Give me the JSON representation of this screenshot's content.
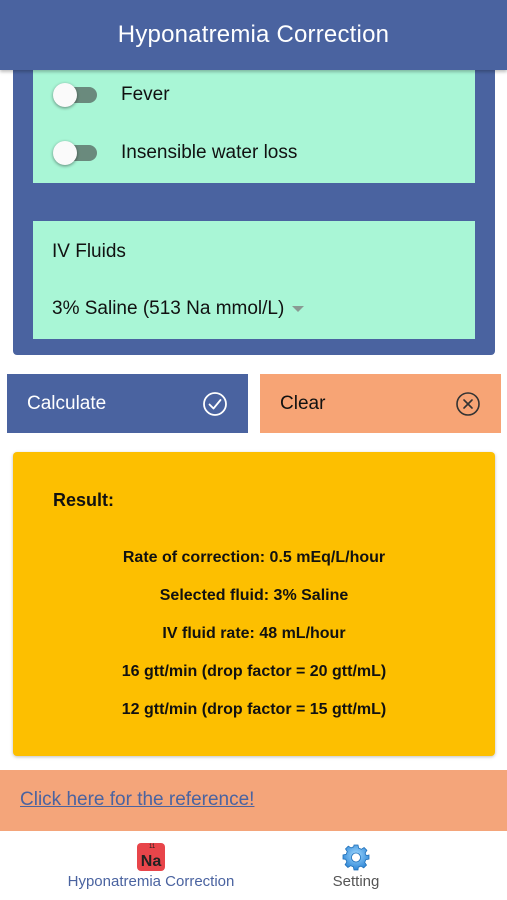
{
  "header": {
    "title": "Hyponatremia Correction"
  },
  "toggles": [
    {
      "label": "Fever",
      "state": "off"
    },
    {
      "label": "Insensible water loss",
      "state": "off"
    }
  ],
  "iv": {
    "title": "IV Fluids",
    "selected": "3% Saline (513 Na mmol/L)"
  },
  "buttons": {
    "calculate": "Calculate",
    "clear": "Clear"
  },
  "result": {
    "title": "Result:",
    "lines": [
      "Rate of correction: 0.5 mEq/L/hour",
      "Selected fluid: 3% Saline",
      "IV fluid rate: 48 mL/hour",
      "16 gtt/min (drop factor = 20 gtt/mL)",
      "12 gtt/min (drop factor = 15 gtt/mL)"
    ]
  },
  "reference": {
    "link_text": "Click here for the reference!"
  },
  "tabbar": {
    "tabs": [
      {
        "label": "Hyponatremia Correction",
        "icon": "sodium-element-icon",
        "icon_text": "Na",
        "icon_num": "11",
        "active": true
      },
      {
        "label": "Setting",
        "icon": "gear-icon",
        "active": false
      }
    ]
  },
  "colors": {
    "primary": "#4a63a0",
    "panel_green": "#a9f6d6",
    "accent_orange": "#f7a475",
    "result_yellow": "#fdbf00"
  }
}
